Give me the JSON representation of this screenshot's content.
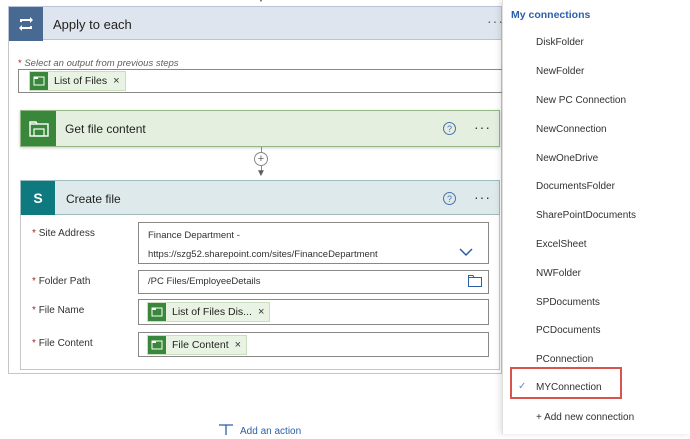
{
  "apply_to_each": {
    "title": "Apply to each",
    "output_label": "Select an output from previous steps",
    "required_mark": "*",
    "token": "List of Files",
    "more": "···"
  },
  "get_file_content": {
    "title": "Get file content",
    "help": "?",
    "more": "···"
  },
  "connector": {
    "plus": "+"
  },
  "create_file": {
    "title": "Create file",
    "icon_letter": "S",
    "help": "?",
    "more": "···",
    "fields": {
      "site_address": {
        "label": "Site Address",
        "line1": "Finance Department -",
        "line2": "https://szg52.sharepoint.com/sites/FinanceDepartment"
      },
      "folder_path": {
        "label": "Folder Path",
        "value": "/PC Files/EmployeeDetails"
      },
      "file_name": {
        "label": "File Name",
        "token": "List of Files Dis..."
      },
      "file_content": {
        "label": "File Content",
        "token": "File Content"
      }
    }
  },
  "add_action": "Add an action",
  "connections_panel": {
    "title": "My connections",
    "items": [
      "DiskFolder",
      "NewFolder",
      "New PC Connection",
      "NewConnection",
      "NewOneDrive",
      "DocumentsFolder",
      "SharePointDocuments",
      "ExcelSheet",
      "NWFolder",
      "SPDocuments",
      "PCDocuments",
      "PConnection",
      "MYConnection"
    ],
    "selected": "MYConnection",
    "add_new": "+ Add new connection"
  },
  "colors": {
    "loop_blue": "#486991",
    "onedrive_green": "#38873a",
    "sharepoint_teal": "#0e7a80",
    "link_blue": "#2b5fa8",
    "highlight_red": "#d9534f"
  },
  "icons": [
    "loop-icon",
    "folder-icon",
    "sharepoint-icon",
    "help-icon",
    "chevron-down-icon",
    "folder-browse-icon",
    "check-icon",
    "close-icon",
    "add-icon"
  ]
}
